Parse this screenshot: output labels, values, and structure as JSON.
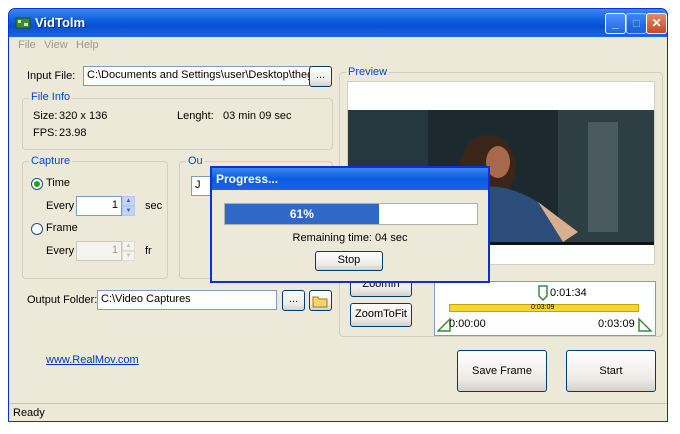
{
  "window": {
    "title": "VidTolm"
  },
  "menu": {
    "items": [
      "File",
      "View",
      "Help"
    ]
  },
  "input_file": {
    "label": "Input File:",
    "value": "C:\\Documents and Settings\\user\\Desktop\\thegol",
    "browse_label": "..."
  },
  "file_info": {
    "title": "File Info",
    "size_label": "Size:",
    "size_value": "320 x 136",
    "length_label": "Lenght:",
    "length_value": "03 min 09 sec",
    "fps_label": "FPS:",
    "fps_value": "23.98"
  },
  "capture": {
    "title": "Capture",
    "time_label": "Time",
    "time_every_label": "Every",
    "time_every_value": "1",
    "time_unit": "sec",
    "frame_label": "Frame",
    "frame_every_label": "Every",
    "frame_every_value": "1",
    "frame_unit": "fr"
  },
  "output_group": {
    "title_fragment": "Ou",
    "partial_value": "J"
  },
  "preview": {
    "title": "Preview"
  },
  "progress_dialog": {
    "title": "Progress...",
    "percent": 61,
    "percent_text": "61%",
    "remaining": "Remaining time: 04 sec",
    "stop_label": "Stop"
  },
  "zoom": {
    "zoom_in_label": "ZoomIn",
    "zoom_fit_label": "ZoomToFit"
  },
  "timeline": {
    "current": "0:01:34",
    "duration_small": "0:03:09",
    "start": "0:00:00",
    "end": "0:03:09"
  },
  "output_folder": {
    "label": "Output Folder:",
    "value": "C:\\Video Captures",
    "browse_label": "..."
  },
  "link": {
    "text": "www.RealMov.com"
  },
  "actions": {
    "save_frame_label": "Save Frame",
    "start_label": "Start"
  },
  "status": {
    "text": "Ready"
  },
  "colors": {
    "accent": "#0a5ce0",
    "group_title": "#0046d5",
    "progress_fill": "#3068c8",
    "timeline_bar": "#f5d630"
  }
}
